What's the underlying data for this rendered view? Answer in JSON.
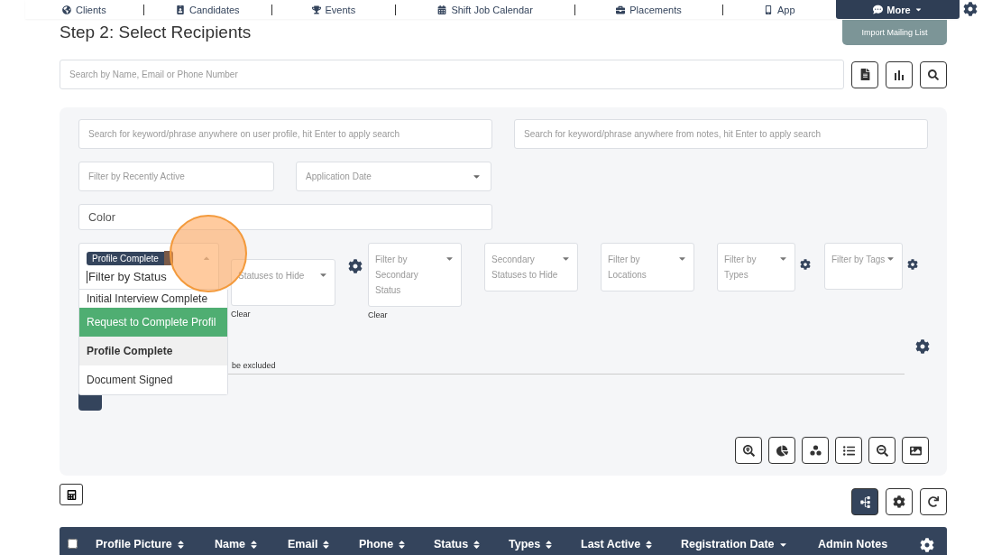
{
  "nav": {
    "items": [
      {
        "label": "Clients"
      },
      {
        "label": "Candidates"
      },
      {
        "label": "Events"
      },
      {
        "label": "Shift Job Calendar"
      },
      {
        "label": "Placements"
      },
      {
        "label": "App"
      }
    ],
    "more": "More"
  },
  "page": {
    "title": "Step 2: Select Recipients",
    "import_button": "Import Mailing List"
  },
  "search": {
    "placeholder": "Search by Name, Email or Phone Number"
  },
  "filters": {
    "profile_search": {
      "placeholder": "Search for keyword/phrase anywhere on user profile, hit Enter to apply search"
    },
    "notes_search": {
      "placeholder": "Search for keyword/phrase anywhere from notes, hit Enter to apply search"
    },
    "recently_active": {
      "placeholder": "Filter by Recently Active"
    },
    "application_date": {
      "placeholder": "Application Date"
    },
    "color": {
      "placeholder": "Color"
    },
    "status": {
      "tags": [
        "Profile Complete"
      ],
      "placeholder": "Filter by Status",
      "expanded": true,
      "options": [
        {
          "label": "Initial Interview Complete",
          "selected": false,
          "highlighted": false
        },
        {
          "label": "Request to Complete Profil",
          "selected": false,
          "highlighted": true
        },
        {
          "label": "Profile Complete",
          "selected": true,
          "highlighted": false
        },
        {
          "label": "Document Signed",
          "selected": false,
          "highlighted": false
        }
      ]
    },
    "selects": [
      {
        "placeholder": "Statuses to Hide",
        "clear": "Clear",
        "gear": true
      },
      {
        "placeholder": "Filter by Secondary Status",
        "clear": "Clear",
        "gear": false
      },
      {
        "placeholder": "Secondary Statuses to Hide",
        "gear": false
      },
      {
        "placeholder": "Filter by Locations",
        "gear": false
      },
      {
        "placeholder": "Filter by Types",
        "gear": true
      },
      {
        "placeholder": "Filter by Tags",
        "gear": true
      }
    ],
    "excluded_note": "be excluded"
  },
  "table": {
    "select_all": {
      "checked": false
    },
    "columns": [
      {
        "label": "Profile Picture",
        "sortable": true,
        "sorted_desc": false
      },
      {
        "label": "Name",
        "sortable": true,
        "sorted_desc": false
      },
      {
        "label": "Email",
        "sortable": true,
        "sorted_desc": false
      },
      {
        "label": "Phone",
        "sortable": true,
        "sorted_desc": false
      },
      {
        "label": "Status",
        "sortable": true,
        "sorted_desc": false
      },
      {
        "label": "Types",
        "sortable": true,
        "sorted_desc": false
      },
      {
        "label": "Last Active",
        "sortable": true,
        "sorted_desc": false
      },
      {
        "label": "Registration Date",
        "sortable": true,
        "sorted_desc": true
      },
      {
        "label": "Admin Notes",
        "sortable": false
      }
    ]
  }
}
